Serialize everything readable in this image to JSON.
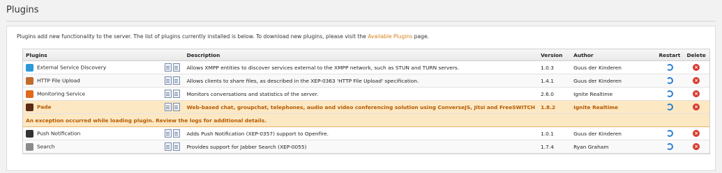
{
  "page": {
    "title": "Plugins",
    "intro_text": "Plugins add new functionality to the server. The list of plugins currently installed is below. To download new plugins, please visit the ",
    "intro_link": "Available Plugins",
    "intro_suffix": " page."
  },
  "table": {
    "headers": {
      "plugins": "Plugins",
      "description": "Description",
      "version": "Version",
      "author": "Author",
      "restart": "Restart",
      "delete": "Delete"
    },
    "rows": [
      {
        "name": "External Service Discovery",
        "description": "Allows XMPP entities to discover services external to the XMPP network, such as STUN and TURN servers.",
        "version": "1.0.3",
        "author": "Guus der Kinderen",
        "icon": "discovery-icon",
        "icon_color": "#2c9ad8"
      },
      {
        "name": "HTTP File Upload",
        "description": "Allows clients to share files, as described in the XEP-0363 'HTTP File Upload' specification.",
        "version": "1.4.1",
        "author": "Guus der Kinderen",
        "icon": "upload-icon",
        "icon_color": "#c26a2b"
      },
      {
        "name": "Monitoring Service",
        "description": "Monitors conversations and statistics of the server.",
        "version": "2.6.0",
        "author": "Ignite Realtime",
        "icon": "monitoring-icon",
        "icon_color": "#e06a1b"
      },
      {
        "name": "Pade",
        "description": "Web-based chat, groupchat, telephones, audio and video conferencing solution using ConverseJS, Jitsi and FreeSWITCH",
        "version": "1.8.2",
        "author": "Ignite Realtime",
        "icon": "pade-icon",
        "icon_color": "#5a2a14",
        "error": true
      },
      {
        "name": "Push Notification",
        "description": "Adds Push Notification (XEP-0357) support to Openfire.",
        "version": "1.0.1",
        "author": "Guus der Kinderen",
        "icon": "bell-icon",
        "icon_color": "#333333"
      },
      {
        "name": "Search",
        "description": "Provides support for Jabber Search (XEP-0055)",
        "version": "1.7.4",
        "author": "Ryan Graham",
        "icon": "search-icon",
        "icon_color": "#8a8a8a"
      }
    ],
    "error_message": "An exception occurred while loading plugin. Review the logs for additional details."
  },
  "colors": {
    "link": "#d8821a",
    "error_bg": "#fde8c4",
    "error_text": "#b35a00",
    "restart_icon": "#2a7fd0",
    "delete_icon": "#d83a2f"
  }
}
